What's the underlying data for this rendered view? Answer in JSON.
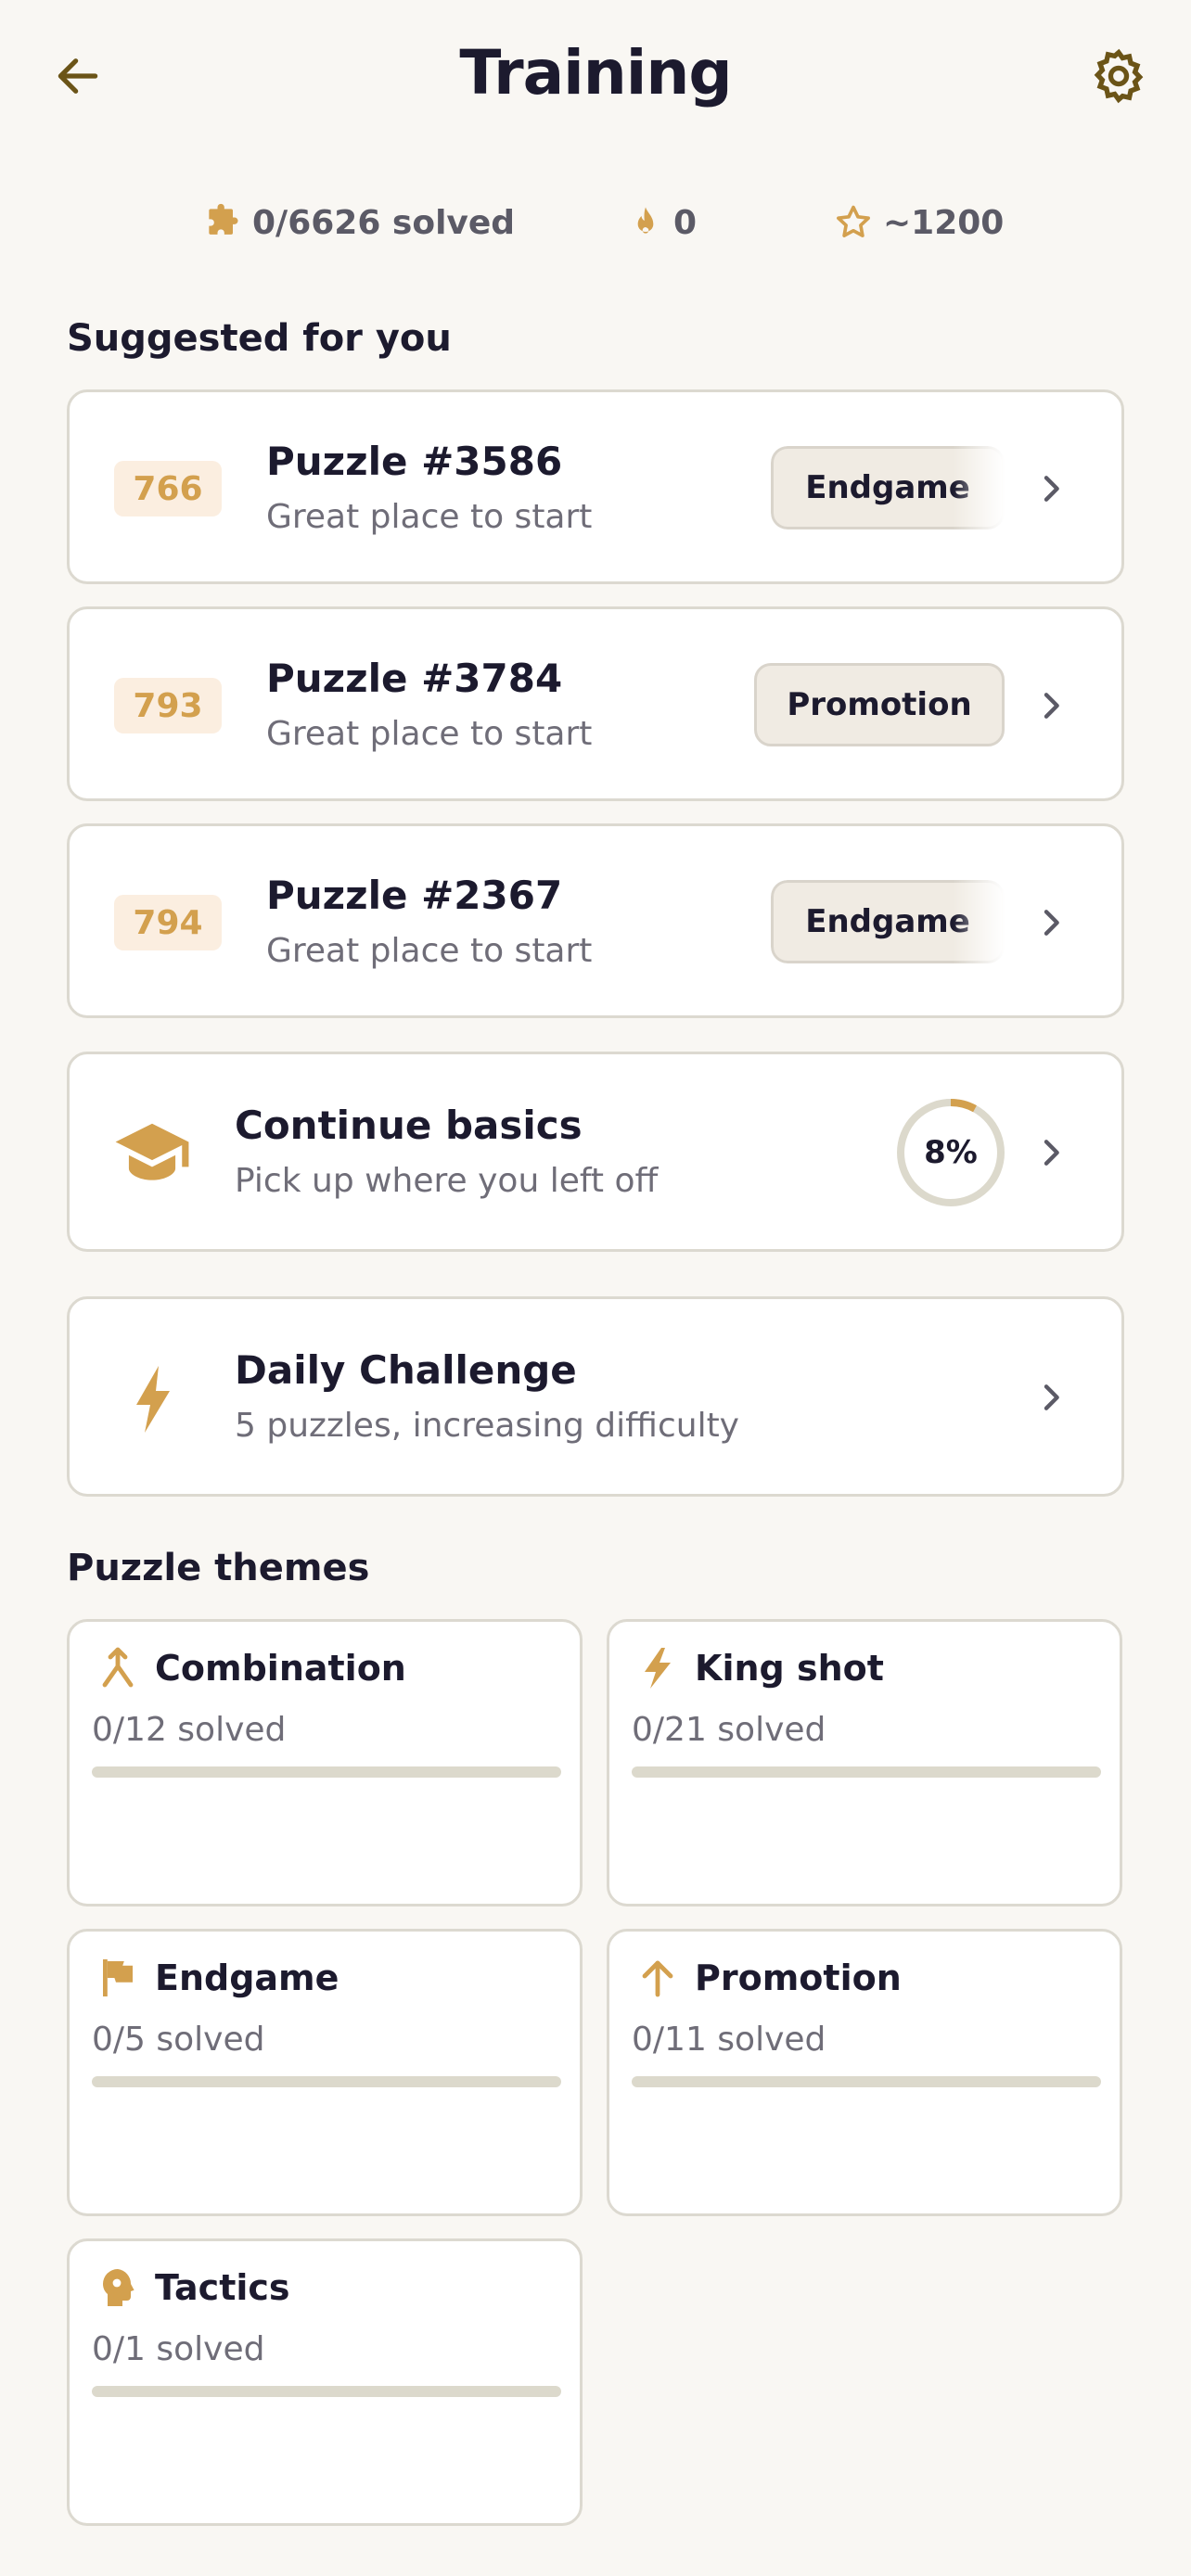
{
  "header": {
    "title": "Training"
  },
  "stats": {
    "solved": "0/6626 solved",
    "streak": "0",
    "rating": "~1200"
  },
  "suggested": {
    "title": "Suggested for you",
    "puzzles": [
      {
        "rating": "766",
        "name": "Puzzle #3586",
        "subtitle": "Great place to start",
        "tag": "Endgame"
      },
      {
        "rating": "793",
        "name": "Puzzle #3784",
        "subtitle": "Great place to start",
        "tag": "Promotion"
      },
      {
        "rating": "794",
        "name": "Puzzle #2367",
        "subtitle": "Great place to start",
        "tag": "Endgame"
      }
    ]
  },
  "basics": {
    "title": "Continue basics",
    "subtitle": "Pick up where you left off",
    "progress_percent": 8,
    "progress_label": "8%"
  },
  "daily": {
    "title": "Daily Challenge",
    "subtitle": "5 puzzles, increasing difficulty"
  },
  "themes": {
    "title": "Puzzle themes",
    "items": [
      {
        "name": "Combination",
        "solved": "0/12 solved",
        "progress": 0,
        "icon": "merge-arrow-icon"
      },
      {
        "name": "King shot",
        "solved": "0/21 solved",
        "progress": 0,
        "icon": "lightning-icon"
      },
      {
        "name": "Endgame",
        "solved": "0/5 solved",
        "progress": 0,
        "icon": "flag-icon"
      },
      {
        "name": "Promotion",
        "solved": "0/11 solved",
        "progress": 0,
        "icon": "arrow-up-icon"
      },
      {
        "name": "Tactics",
        "solved": "0/1 solved",
        "progress": 0,
        "icon": "head-gear-icon"
      }
    ]
  },
  "colors": {
    "accent": "#d3a04e",
    "background": "#f9f7f3",
    "card": "#ffffff",
    "border": "#dcd9d0",
    "text": "#1c1a2e",
    "muted": "#6f6d78"
  }
}
